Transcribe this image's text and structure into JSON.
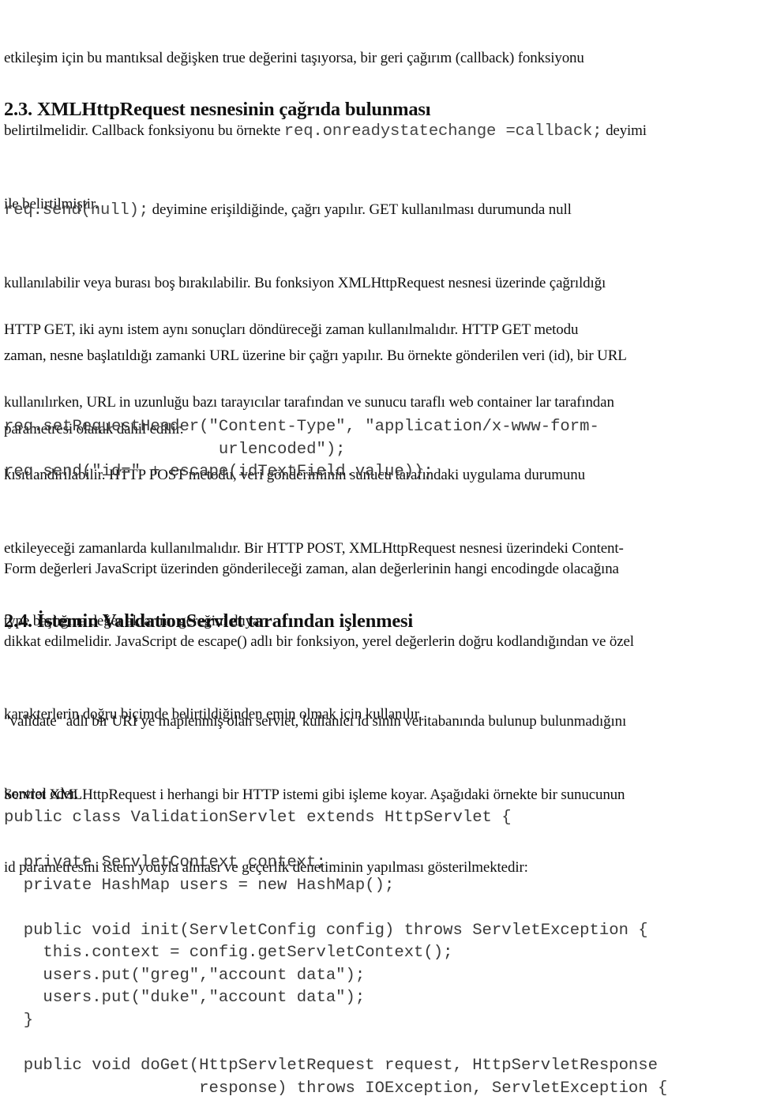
{
  "document": {
    "intro_paragraph": {
      "line1": "etkileşim için bu mantıksal değişken true değerini taşıyorsa, bir geri çağırım (callback) fonksiyonu",
      "line2_before": "belirtilmelidir. Callback fonksiyonu bu örnekte ",
      "line2_code": "req.onreadystatechange =callback;",
      "line2_after": " deyimi",
      "line3": "ile belirtilmiştir."
    },
    "section_2_3": {
      "heading": "2.3. XMLHttpRequest nesnesinin çağrıda bulunması",
      "paragraph1": {
        "line1_code": "req.send(null);",
        "line1_after": " deyimine erişildiğinde,  çağrı yapılır. GET kullanılması durumunda null",
        "line2": "kullanılabilir veya burası boş bırakılabilir. Bu fonksiyon XMLHttpRequest nesnesi üzerinde çağrıldığı",
        "line3": "zaman, nesne başlatıldığı zamanki URL üzerine bir çağrı yapılır. Bu örnekte gönderilen veri (id), bir URL",
        "line4": "parametresi olarak dahil edilir."
      },
      "paragraph2": {
        "lines": [
          "HTTP GET, iki aynı istem aynı sonuçları döndüreceği zaman kullanılmalıdır. HTTP GET metodu",
          "kullanılırken, URL in uzunluğu bazı tarayıcılar tarafından ve sunucu taraflı web container lar tarafından",
          "kısıtlandırılabilir. HTTP POST metodu, veri gönderiminin sunucu tarafındaki uygulama durumunu",
          "etkileyeceği zamanlarda kullanılmalıdır. Bir HTTP POST, XMLHttpRequest nesnesi üzerindeki Content-",
          "type başlığına değer aktarımı gereğini duyar:"
        ]
      },
      "code_block": {
        "lines": [
          "req.setRequestHeader(\"Content-Type\", \"application/x-www-form-",
          "                      urlencoded\");",
          "req.send(\"id=\" + escape(idTextField.value));"
        ]
      },
      "paragraph3": {
        "lines": [
          "Form değerleri JavaScript üzerinden gönderileceği zaman, alan değerlerinin hangi encodingde olacağına",
          "dikkat edilmelidir. JavaScript de escape() adlı bir fonksiyon, yerel değerlerin doğru kodlandığından ve özel",
          "karakterlerin doğru biçimde belirtildiğinden emin olmak için kullanılır."
        ]
      }
    },
    "section_2_4": {
      "heading": "2.4. İstemin ValidationServlet tarafından işlenmesi",
      "paragraph1": {
        "lines": [
          "\"validate\" adlı bir URI ye maplenmiş olan servlet, kullanıcı id sinin veritabanında bulunup bulunmadığını",
          "kontrol eder."
        ]
      },
      "paragraph2": {
        "lines": [
          "Servlet XMLHttpRequest i herhangi bir HTTP istemi gibi işleme koyar. Aşağıdaki örnekte bir sunucunun",
          "id parametresini istem youyla alması ve geçerlik denetiminin yapılması gösterilmektedir:"
        ]
      },
      "code_block": {
        "lines": [
          "public class ValidationServlet extends HttpServlet {",
          "",
          "  private ServletContext context;",
          "  private HashMap users = new HashMap();",
          "",
          "  public void init(ServletConfig config) throws ServletException {",
          "    this.context = config.getServletContext();",
          "    users.put(\"greg\",\"account data\");",
          "    users.put(\"duke\",\"account data\");",
          "  }",
          "",
          "  public void doGet(HttpServletRequest request, HttpServletResponse",
          "                    response) throws IOException, ServletException {"
        ]
      }
    }
  }
}
